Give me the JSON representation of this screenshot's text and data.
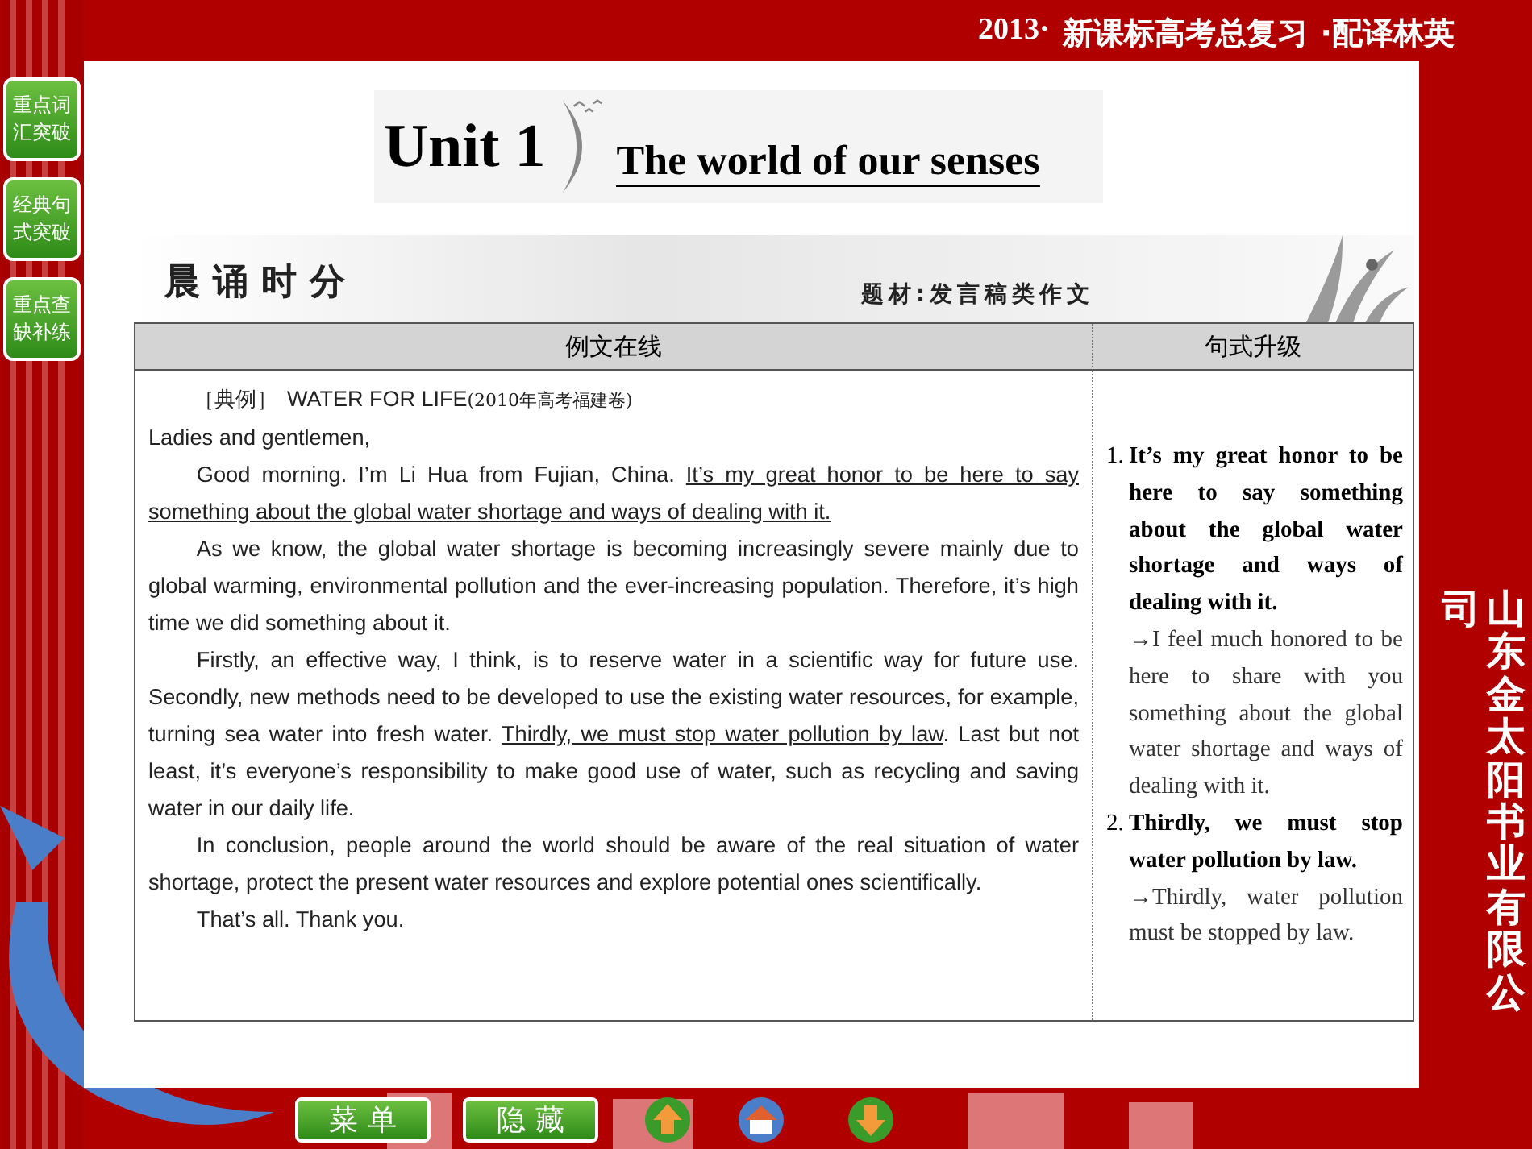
{
  "header": {
    "year": "2013·",
    "title": "新课标高考总复习",
    "edition": "·配译林英"
  },
  "side_nav": [
    {
      "label": "重点词汇突破"
    },
    {
      "label": "经典句式突破"
    },
    {
      "label": "重点查缺补练"
    }
  ],
  "unit": {
    "number": "Unit 1",
    "title": "The world of our senses"
  },
  "section": {
    "title": "晨诵时分",
    "topic": "题材:发言稿类作文"
  },
  "table": {
    "columns": [
      "例文在线",
      "句式升级"
    ],
    "example": {
      "tag": "［典例］",
      "title": "WATER FOR LIFE",
      "source": "(2010年高考福建卷)",
      "paragraphs": [
        {
          "indent": false,
          "segments": [
            {
              "text": "Ladies and gentlemen,",
              "underlined": false
            }
          ]
        },
        {
          "indent": true,
          "segments": [
            {
              "text": "Good morning. I’m Li Hua from Fujian, China. ",
              "underlined": false
            },
            {
              "text": "It’s my great honor to be here to say something about the global water shortage and ways of dealing with it.",
              "underlined": true
            }
          ]
        },
        {
          "indent": true,
          "segments": [
            {
              "text": "As we know, the global water shortage is becoming increasingly severe mainly due to global warming, environmental pollution and the ever-increasing population. Therefore, it’s high time we did something about it.",
              "underlined": false
            }
          ]
        },
        {
          "indent": true,
          "segments": [
            {
              "text": "Firstly, an effective way, I think, is to reserve water in a scientific way for future use. Secondly, new methods need to be developed to use the existing water resources, for example, turning sea water into fresh water. ",
              "underlined": false
            },
            {
              "text": "Thirdly, we must stop water pollution by law",
              "underlined": true
            },
            {
              "text": ". Last but not least, it’s everyone’s responsibility to make good use of water, such as recycling and saving water in our daily life.",
              "underlined": false
            }
          ]
        },
        {
          "indent": true,
          "segments": [
            {
              "text": "In conclusion, people around the world should be aware of the real situation of water shortage, protect the present water resources and explore potential ones scientifically.",
              "underlined": false
            }
          ]
        },
        {
          "indent": true,
          "segments": [
            {
              "text": "That’s all. Thank you.",
              "underlined": false
            }
          ]
        }
      ]
    },
    "upgrades": [
      {
        "number": "1.",
        "sentence": "It’s my great honor to be here to say something about the global water shortage and ways of dealing with it.",
        "rewrite": "→I feel much honored to be here to share with you something about the global water shortage and ways of dealing with it."
      },
      {
        "number": "2.",
        "sentence": "Thirdly, we must stop water pollution by law.",
        "rewrite": "→Thirdly, water pollution must be stopped by law."
      }
    ]
  },
  "vertical_banner": {
    "cut_char": "司",
    "text": "山东金太阳书业有限公"
  },
  "bottom_buttons": [
    "菜 单",
    "隐 藏"
  ]
}
